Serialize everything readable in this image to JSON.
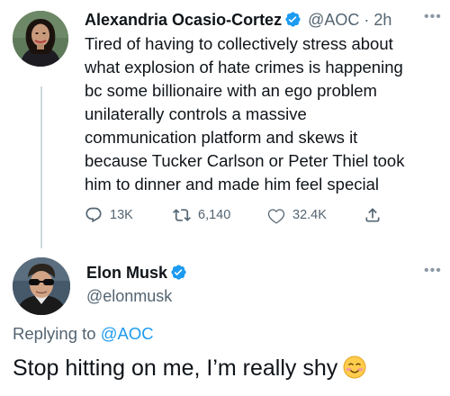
{
  "tweet1": {
    "author_name": "Alexandria Ocasio-Cortez",
    "handle": "@AOC",
    "separator": "·",
    "time": "2h",
    "more_icon": "more-horizontal-icon",
    "text_lines": [
      "Tired of having to collectively stress about",
      "what explosion of hate crimes is happening",
      "bc some billionaire with an ego problem",
      "unilaterally controls a massive",
      "communication platform and skews it",
      "because Tucker Carlson or Peter Thiel took",
      "him to dinner and made him feel special"
    ],
    "actions": {
      "replies": "13K",
      "retweets": "6,140",
      "likes": "32.4K"
    }
  },
  "tweet2": {
    "author_name": "Elon Musk",
    "handle": "@elonmusk",
    "more_icon": "more-horizontal-icon",
    "replying_prefix": "Replying to",
    "replying_to": "@AOC",
    "text": "Stop hitting on me, I’m really shy",
    "emoji": "smiling-face-icon"
  },
  "colors": {
    "verified_blue": "#1d9bf0",
    "secondary_text": "#536471",
    "primary_text": "#0f1419",
    "thread_line": "#cfd9de"
  }
}
